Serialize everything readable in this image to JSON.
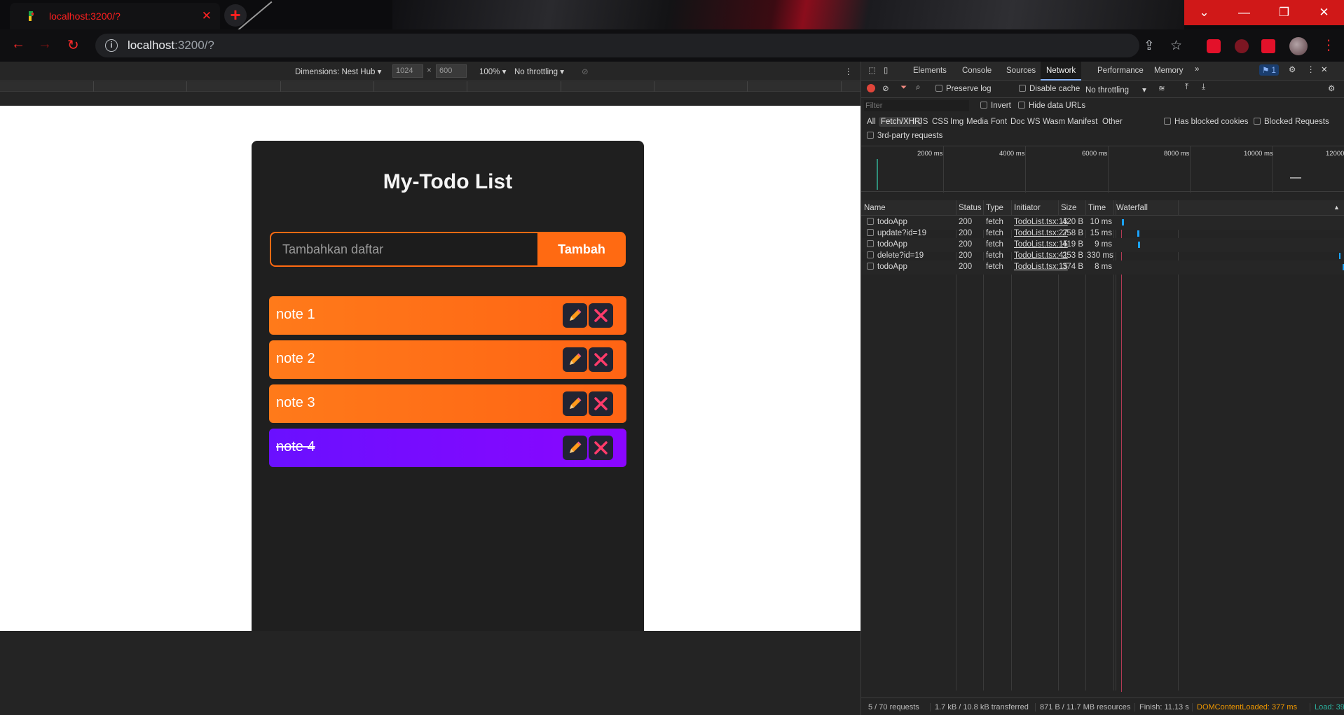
{
  "browser": {
    "tab_title": "localhost:3200/?",
    "url_host": "localhost",
    "url_rest": ":3200/?"
  },
  "device_toolbar": {
    "dimensions": "Dimensions: Nest Hub",
    "width": "1024",
    "height": "600",
    "zoom": "100%",
    "throttling": "No throttling"
  },
  "app": {
    "title": "My-Todo List",
    "input_placeholder": "Tambahkan daftar",
    "add_button": "Tambah",
    "todos": [
      {
        "text": "note 1",
        "done": false
      },
      {
        "text": "note 2",
        "done": false
      },
      {
        "text": "note 3",
        "done": false
      },
      {
        "text": "note 4",
        "done": true
      }
    ]
  },
  "devtools": {
    "tabs": [
      "Elements",
      "Console",
      "Sources",
      "Network",
      "Performance",
      "Memory"
    ],
    "active_tab": "Network",
    "issues_count": "1",
    "toolbar": {
      "preserve_log": "Preserve log",
      "disable_cache": "Disable cache",
      "throttling": "No throttling"
    },
    "filter": {
      "placeholder": "Filter",
      "invert": "Invert",
      "hide_data_urls": "Hide data URLs"
    },
    "types": [
      "All",
      "Fetch/XHR",
      "JS",
      "CSS",
      "Img",
      "Media",
      "Font",
      "Doc",
      "WS",
      "Wasm",
      "Manifest",
      "Other"
    ],
    "selected_type": "Fetch/XHR",
    "has_blocked_cookies": "Has blocked cookies",
    "blocked_requests": "Blocked Requests",
    "third_party": "3rd-party requests",
    "overview_ticks": [
      "2000 ms",
      "4000 ms",
      "6000 ms",
      "8000 ms",
      "10000 ms",
      "12000"
    ],
    "columns": [
      "Name",
      "Status",
      "Type",
      "Initiator",
      "Size",
      "Time",
      "Waterfall"
    ],
    "requests": [
      {
        "name": "todoApp",
        "status": "200",
        "type": "fetch",
        "initiator": "TodoList.tsx:15",
        "size": "420 B",
        "time": "10 ms"
      },
      {
        "name": "update?id=19",
        "status": "200",
        "type": "fetch",
        "initiator": "TodoList.tsx:27",
        "size": "258 B",
        "time": "15 ms"
      },
      {
        "name": "todoApp",
        "status": "200",
        "type": "fetch",
        "initiator": "TodoList.tsx:15",
        "size": "419 B",
        "time": "9 ms"
      },
      {
        "name": "delete?id=19",
        "status": "200",
        "type": "fetch",
        "initiator": "TodoList.tsx:41",
        "size": "253 B",
        "time": "330 ms"
      },
      {
        "name": "todoApp",
        "status": "200",
        "type": "fetch",
        "initiator": "TodoList.tsx:15",
        "size": "374 B",
        "time": "8 ms"
      }
    ],
    "status_bar": {
      "requests": "5 / 70 requests",
      "transferred": "1.7 kB / 10.8 kB transferred",
      "resources": "871 B / 11.7 MB resources",
      "finish": "Finish: 11.13 s",
      "dom_loaded": "DOMContentLoaded: 377 ms",
      "load": "Load: 39"
    }
  },
  "colors": {
    "accent": "#ff6a12",
    "done_todo": "#7a0aff",
    "card": "#1f1f1f",
    "chrome_red": "#d01818"
  }
}
